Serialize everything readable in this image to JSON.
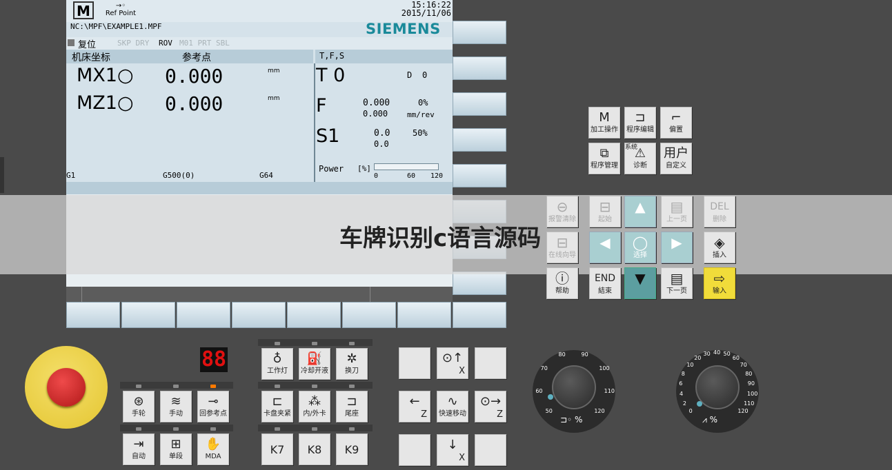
{
  "screen": {
    "header": {
      "mode_label": "Ref Point",
      "time": "15:16:22",
      "date": "2015/11/06",
      "path": "NC:\\MPF\\EXAMPLE1.MPF",
      "brand": "SIEMENS"
    },
    "status": {
      "state": "复位",
      "flags_dim1": "SKP DRY",
      "flag_rov": "ROV",
      "flags_dim2": "M01 PRT SBL"
    },
    "coords": {
      "title": "机床坐标",
      "subtitle": "参考点",
      "rows": [
        {
          "axis": "MX1○",
          "value": "0.000",
          "unit": "mm"
        },
        {
          "axis": "MZ1○",
          "value": "0.000",
          "unit": "mm"
        }
      ]
    },
    "tfs": {
      "title": "T,F,S",
      "tool": "T 0",
      "d_label": "D",
      "d_value": "0",
      "f_label": "F",
      "f_v1": "0.000",
      "f_v2": "0.000",
      "f_pct": "0%",
      "f_unit": "mm/rev",
      "s_label": "S1",
      "s_v1": "0.0",
      "s_v2": "0.0",
      "s_pct": "50%",
      "power_label": "Power",
      "power_unit": "[%]",
      "power_ticks": [
        "0",
        "60",
        "120"
      ],
      "power_level_percent": 0
    },
    "gcodes": [
      "G1",
      "G500(0)",
      "G64"
    ]
  },
  "overlay_title": "车牌识别c语言源码",
  "func_keys": [
    {
      "label": "加工操作",
      "icon": "M"
    },
    {
      "label": "程序编辑",
      "icon": "⊐"
    },
    {
      "label": "偏置",
      "icon": "⌐"
    },
    {
      "label": "程序管理",
      "icon": "⧉"
    },
    {
      "label": "诊断",
      "icon": "⚠",
      "top": "系统"
    },
    {
      "label": "自定义",
      "icon": "用户"
    }
  ],
  "edit_keys": [
    {
      "label": "报警清除",
      "icon": "⊖",
      "dim": true
    },
    {
      "label": "起始",
      "icon": "⊟",
      "dim": true
    },
    {
      "label": "",
      "icon": "▲",
      "kind": "blue"
    },
    {
      "label": "上一页",
      "icon": "▤",
      "dim": true
    },
    {
      "label": "删除",
      "icon": "DEL",
      "dim": true
    },
    {
      "label": "在线向导",
      "icon": "⊟",
      "dim": true
    },
    {
      "label": "",
      "icon": "◀",
      "kind": "blue"
    },
    {
      "label": "选择",
      "icon": "◯",
      "kind": "blue"
    },
    {
      "label": "",
      "icon": "▶",
      "kind": "blue"
    },
    {
      "label": "插入",
      "icon": "◈"
    },
    {
      "label": "帮助",
      "icon": "ⓘ"
    },
    {
      "label": "結束",
      "icon": "END"
    },
    {
      "label": "",
      "icon": "▼",
      "kind": "teal"
    },
    {
      "label": "下一页",
      "icon": "▤"
    },
    {
      "label": "输入",
      "icon": "⇨",
      "kind": "yellow"
    }
  ],
  "machine_keys": {
    "row1": [
      {
        "label": "工作灯",
        "icon": "♁"
      },
      {
        "label": "冷却开液",
        "icon": "⛽"
      },
      {
        "label": "换刀",
        "icon": "✲"
      }
    ],
    "row2_left": [
      {
        "label": "手轮",
        "icon": "⊛"
      },
      {
        "label": "手动",
        "icon": "≋"
      },
      {
        "label": "回参考点",
        "icon": "⊸"
      }
    ],
    "row2_right": [
      {
        "label": "卡盘夹紧",
        "icon": "⊏"
      },
      {
        "label": "内/外卡",
        "icon": "⁂"
      },
      {
        "label": "尾座",
        "icon": "⊐"
      }
    ],
    "row3_left": [
      {
        "label": "自动",
        "icon": "⇥"
      },
      {
        "label": "单段",
        "icon": "⊞"
      },
      {
        "label": "MDA",
        "icon": "✋"
      }
    ],
    "row3_right": [
      {
        "label": "K7"
      },
      {
        "label": "K8"
      },
      {
        "label": "K9"
      }
    ]
  },
  "jog_keys": {
    "up_x": "X",
    "left_z": "Z",
    "rapid": "快速移动",
    "right_z": "Z",
    "down_x": "X"
  },
  "display_7seg": "88",
  "dial_feed": {
    "ticks": [
      "50",
      "60",
      "70",
      "80",
      "90",
      "100",
      "110",
      "120"
    ],
    "unit": "%"
  },
  "dial_spindle": {
    "ticks": [
      "0",
      "2",
      "4",
      "6",
      "8",
      "10",
      "20",
      "30",
      "40",
      "50",
      "60",
      "70",
      "80",
      "90",
      "100",
      "110",
      "120"
    ],
    "unit": "%"
  }
}
